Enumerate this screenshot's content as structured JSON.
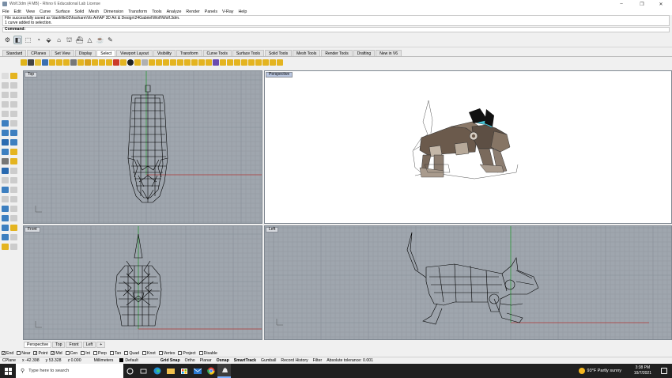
{
  "window": {
    "title": "Wolf.3dm (4 MB) - Rhino 6 Educational Lab License",
    "controls": [
      "–",
      "❐",
      "✕"
    ]
  },
  "menu": [
    "File",
    "Edit",
    "View",
    "Curve",
    "Surface",
    "Solid",
    "Mesh",
    "Dimension",
    "Transform",
    "Tools",
    "Analyze",
    "Render",
    "Panels",
    "V-Ray",
    "Help"
  ],
  "command": {
    "history": [
      "File successfully saved as \\\\tashfile03\\hsshare\\Vis Art\\AP 3D Art & Design\\24Gabriel\\Wolf\\Wolf.3dm.",
      "1 curve added to selection."
    ],
    "prompt": "Command:"
  },
  "tabs": [
    "Standard",
    "CPlanes",
    "Set View",
    "Display",
    "Select",
    "Viewport Layout",
    "Visibility",
    "Transform",
    "Curve Tools",
    "Surface Tools",
    "Solid Tools",
    "Mesh Tools",
    "Render Tools",
    "Drafting",
    "New in V6"
  ],
  "active_tab": "Select",
  "viewports": {
    "top": "Top",
    "perspective": "Perspective",
    "front": "Front",
    "left": "Left"
  },
  "view_tabs": [
    "Perspective",
    "Top",
    "Front",
    "Left",
    "+"
  ],
  "osnaps": [
    {
      "label": "End",
      "checked": true
    },
    {
      "label": "Near",
      "checked": false
    },
    {
      "label": "Point",
      "checked": true
    },
    {
      "label": "Mid",
      "checked": true
    },
    {
      "label": "Cen",
      "checked": false
    },
    {
      "label": "Int",
      "checked": false
    },
    {
      "label": "Perp",
      "checked": false
    },
    {
      "label": "Tan",
      "checked": false
    },
    {
      "label": "Quad",
      "checked": false
    },
    {
      "label": "Knot",
      "checked": false
    },
    {
      "label": "Vertex",
      "checked": false
    },
    {
      "label": "Project",
      "checked": false
    },
    {
      "label": "Disable",
      "checked": false
    }
  ],
  "status": {
    "cplane": "CPlane",
    "x": "x -42.398",
    "y": "y 53.328",
    "z": "z 0.000",
    "units": "Millimeters",
    "layer": "Default",
    "modes": [
      {
        "label": "Grid Snap",
        "bold": true
      },
      {
        "label": "Ortho",
        "bold": false
      },
      {
        "label": "Planar",
        "bold": false
      },
      {
        "label": "Osnap",
        "bold": true
      },
      {
        "label": "SmartTrack",
        "bold": true
      },
      {
        "label": "Gumball",
        "bold": false
      },
      {
        "label": "Record History",
        "bold": false
      },
      {
        "label": "Filter",
        "bold": false
      }
    ],
    "tolerance": "Absolute tolerance: 0.001"
  },
  "taskbar": {
    "search_placeholder": "Type here to search",
    "weather": "93°F  Partly sunny",
    "time": "3:38 PM",
    "date": "10/7/2021"
  },
  "colors": {
    "viewport_bg": "#9fa6ae",
    "grid_line": "#8d949c",
    "x_axis": "#b13a3a",
    "y_axis": "#2f9a3a",
    "active_title": "#b9c6e0"
  }
}
